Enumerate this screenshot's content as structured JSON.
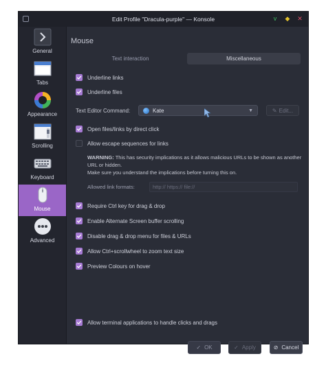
{
  "window": {
    "title": "Edit Profile \"Dracula-purple\" — Konsole",
    "buttons": {
      "minimize": "v",
      "maximize": "◆",
      "close": "✕"
    }
  },
  "sidebar": {
    "items": [
      {
        "label": "General",
        "icon": "general-icon"
      },
      {
        "label": "Tabs",
        "icon": "tabs-icon"
      },
      {
        "label": "Appearance",
        "icon": "appearance-icon"
      },
      {
        "label": "Scrolling",
        "icon": "scrolling-icon"
      },
      {
        "label": "Keyboard",
        "icon": "keyboard-icon"
      },
      {
        "label": "Mouse",
        "icon": "mouse-icon",
        "active": true
      },
      {
        "label": "Advanced",
        "icon": "advanced-icon"
      }
    ]
  },
  "page": {
    "title": "Mouse",
    "tabs": [
      "Text interaction",
      "Miscellaneous"
    ],
    "selected_tab": "Miscellaneous"
  },
  "options": {
    "underline_links": "Underline links",
    "underline_files": "Underline files",
    "text_editor_label": "Text Editor Command:",
    "text_editor_value": "Kate",
    "edit_button": "Edit...",
    "open_links": "Open files/links by direct click",
    "allow_escape": "Allow escape sequences for links",
    "warning_bold": "WARNING:",
    "warning_text": " This has security implications as it allows malicious URLs to be shown as another URL or hidden.",
    "warning_text2": "Make sure you understand the implications before turning this on.",
    "allowed_formats_label": "Allowed link formats:",
    "allowed_formats_value": "http:// https:// file://",
    "require_ctrl": "Require Ctrl key for drag & drop",
    "alternate_screen": "Enable Alternate Screen buffer scrolling",
    "disable_dnd_menu": "Disable drag & drop menu for files & URLs",
    "ctrl_scroll_zoom": "Allow Ctrl+scrollwheel to zoom text size",
    "preview_colours": "Preview Colours on hover",
    "terminal_apps": "Allow terminal applications to handle clicks and drags"
  },
  "footer": {
    "ok": "OK",
    "apply": "Apply",
    "cancel": "Cancel"
  },
  "colors": {
    "accent": "#9a66c7",
    "checkbox": "#a77bd4",
    "background": "#2a2d37"
  }
}
